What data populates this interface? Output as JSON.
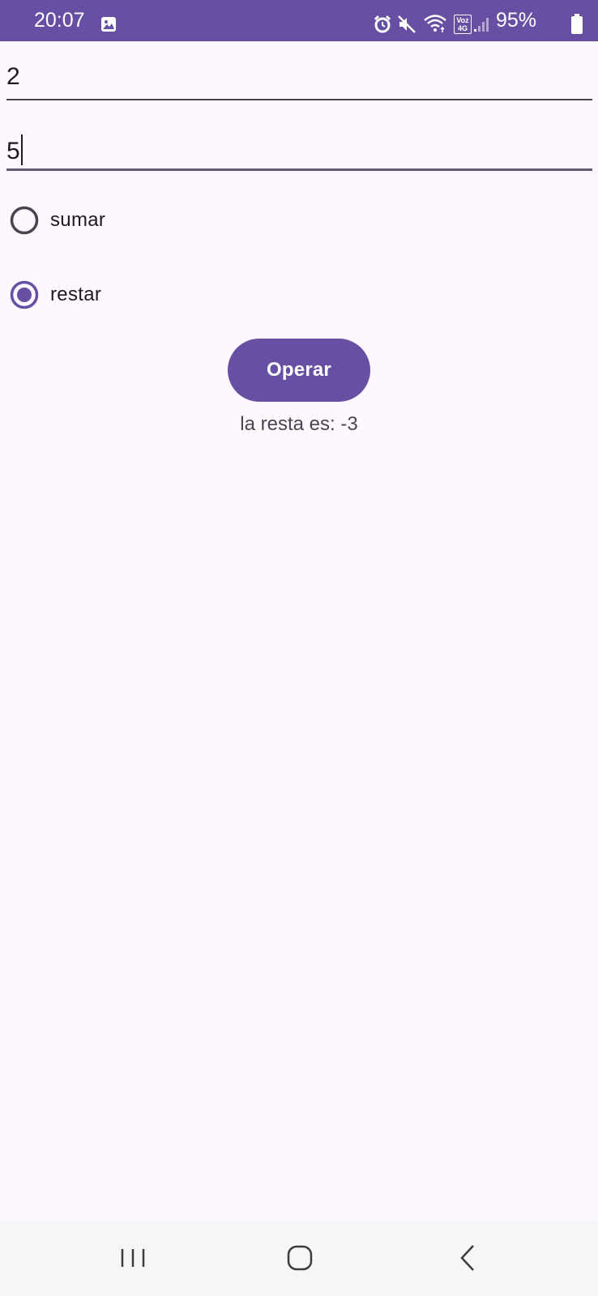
{
  "status_bar": {
    "time": "20:07",
    "battery": "95%",
    "background_color": "#6750A4",
    "icons": [
      "gallery-icon",
      "alarm-icon",
      "mute-icon",
      "wifi-icon",
      "volte-icon",
      "signal-icon",
      "battery-icon"
    ],
    "volte_text": "Voz 4G"
  },
  "form": {
    "field1_value": "2",
    "field2_value": "5",
    "options": [
      {
        "label": "sumar",
        "selected": false
      },
      {
        "label": "restar",
        "selected": true
      }
    ],
    "button_label": "Operar",
    "result": "la resta es: -3"
  },
  "colors": {
    "accent": "#6750A4",
    "background": "#FDF7FF",
    "text": "#1D1B20",
    "secondary_text": "#49454F"
  },
  "nav_bar": {
    "icons": [
      "recents-icon",
      "home-icon",
      "back-icon"
    ]
  }
}
